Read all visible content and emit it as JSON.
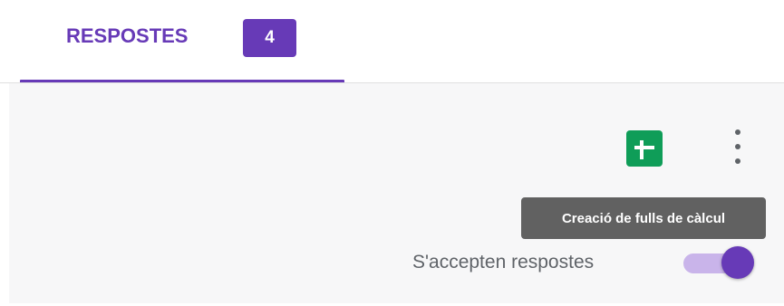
{
  "tabs": [
    {
      "label": "RESPOSTES",
      "badge": "4",
      "active": true
    }
  ],
  "colors": {
    "accent": "#673ab7",
    "sheets_green": "#0f9d58",
    "tooltip_bg": "#616161",
    "panel_bg": "#f7f7f8"
  },
  "toolbar": {
    "sheets_icon": "google-sheets-icon",
    "more_icon": "more-vert-icon"
  },
  "tooltip": {
    "text": "Creació de fulls de càlcul"
  },
  "responses_toggle": {
    "label": "S'accepten respostes",
    "checked": true
  }
}
